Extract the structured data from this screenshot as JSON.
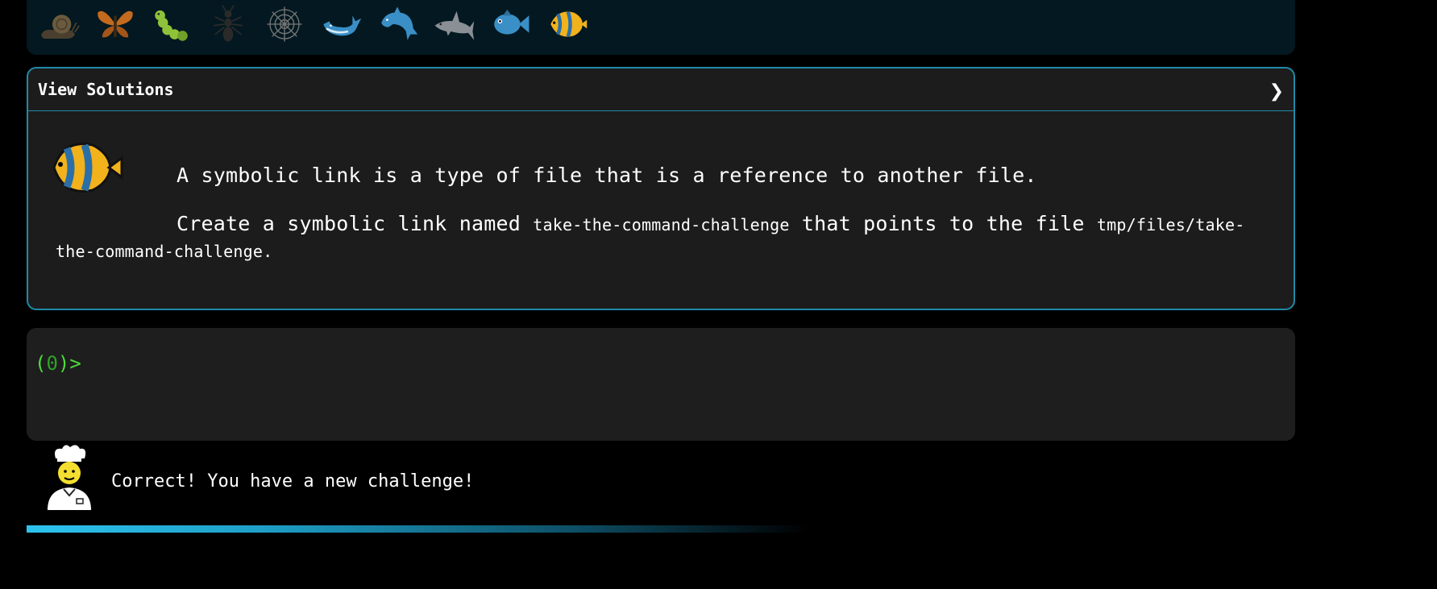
{
  "creatures": [
    {
      "icon": "snail-icon",
      "color": "#6b5a3e"
    },
    {
      "icon": "butterfly-icon",
      "color": "#c46a1f"
    },
    {
      "icon": "caterpillar-icon",
      "color": "#8fc23a"
    },
    {
      "icon": "ant-icon",
      "color": "#333333"
    },
    {
      "icon": "spider-web-icon",
      "color": "#777777"
    },
    {
      "icon": "whale-icon",
      "color": "#3a8fc7"
    },
    {
      "icon": "dolphin-icon",
      "color": "#3a8fc7"
    },
    {
      "icon": "shark-icon",
      "color": "#8a8f96"
    },
    {
      "icon": "fish-icon",
      "color": "#3a8fc7"
    },
    {
      "icon": "tropical-fish-icon",
      "color": "#f1b21b"
    }
  ],
  "challenge": {
    "title": "View Solutions",
    "chevron": "❯",
    "description": "A symbolic link is a type of file that is a reference to another file.",
    "task_prefix": "Create a symbolic link named ",
    "task_link_name": "take-the-command-challenge",
    "task_middle": " that points to the file ",
    "task_target": "tmp/files/take-the-command-challenge",
    "task_suffix": "."
  },
  "terminal": {
    "prompt_open": "(",
    "prompt_count": "0",
    "prompt_close": ")>"
  },
  "message": {
    "text": "Correct! You have a new challenge!"
  },
  "colors": {
    "accent": "#1f8aa8",
    "prompt": "#4ddc3c",
    "progress": "#2dc3ee"
  }
}
